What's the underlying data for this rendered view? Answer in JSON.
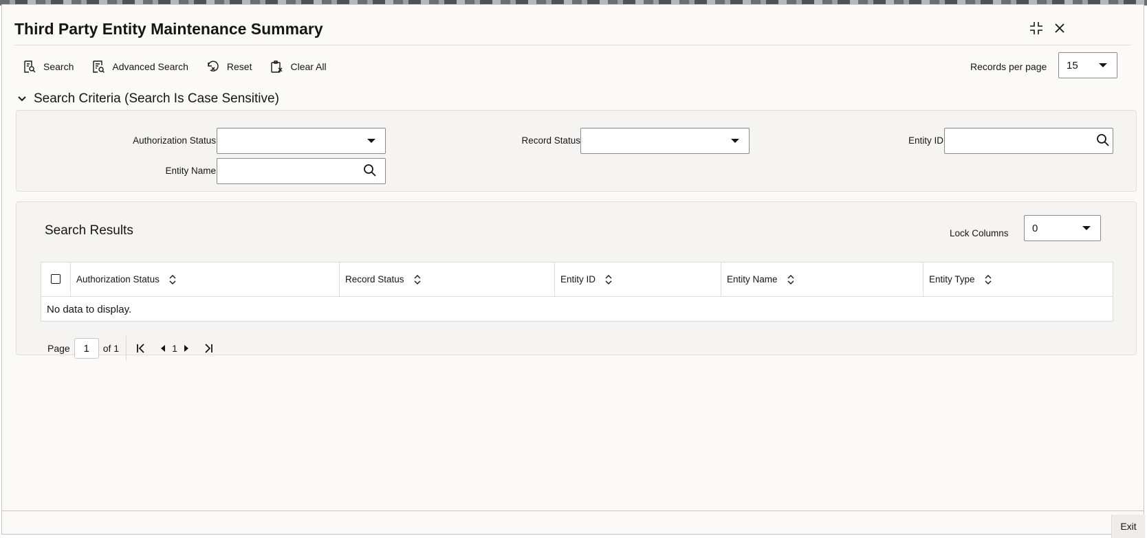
{
  "window": {
    "title": "Third Party Entity Maintenance Summary"
  },
  "icons": {
    "maximize": "fullscreen-exit-icon",
    "close": "close-icon",
    "search": "search-doc-icon",
    "advanced_search": "advanced-search-icon",
    "reset": "reset-icon",
    "clear_all": "clipboard-icon",
    "collapse": "chevron-down-icon",
    "field_search": "magnifier-icon",
    "sort": "sort-icon"
  },
  "toolbar": {
    "search": "Search",
    "advanced_search": "Advanced Search",
    "reset": "Reset",
    "clear_all": "Clear All"
  },
  "records_per_page": {
    "label": "Records per page",
    "value": "15"
  },
  "criteria": {
    "heading": "Search Criteria (Search Is Case Sensitive)",
    "authorization_status": {
      "label": "Authorization Status",
      "value": ""
    },
    "record_status": {
      "label": "Record Status",
      "value": ""
    },
    "entity_id": {
      "label": "Entity ID",
      "value": ""
    },
    "entity_name": {
      "label": "Entity Name",
      "value": ""
    }
  },
  "results": {
    "title": "Search Results",
    "lock_columns": {
      "label": "Lock Columns",
      "value": "0"
    },
    "columns": [
      "Authorization Status",
      "Record Status",
      "Entity ID",
      "Entity Name",
      "Entity Type"
    ],
    "empty_message": "No data to display."
  },
  "pager": {
    "page_label": "Page",
    "current": "1",
    "of_label": "of 1",
    "page_number": "1"
  },
  "footer": {
    "exit": "Exit"
  },
  "colors": {
    "accent_border": "#8d8a84",
    "panel_bg": "#f5f4f2",
    "text": "#161513"
  }
}
